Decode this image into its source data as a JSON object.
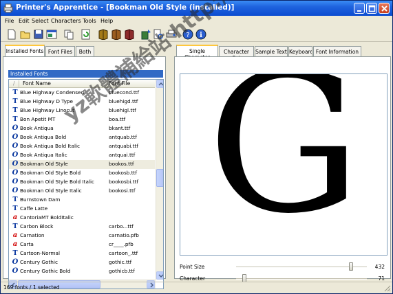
{
  "window": {
    "title": "Printer's Apprentice - [Bookman Old Style (installed)]"
  },
  "menu": [
    "File",
    "Edit",
    "Select",
    "Characters",
    "Tools",
    "Help"
  ],
  "toolbar_icons": [
    "new-icon",
    "open-icon",
    "save-icon",
    "properties-icon",
    "copy-icon",
    "refresh-icon",
    "book-icon",
    "book-red-icon",
    "book-purple-icon",
    "install-icon",
    "print-preview-icon",
    "print-icon",
    "help-icon",
    "info-icon"
  ],
  "left_tabs": [
    "Installed Fonts",
    "Font Files",
    "Both"
  ],
  "installed_header": "Installed Fonts",
  "columns": {
    "name": "Font Name",
    "file": "Font File"
  },
  "fonts": [
    {
      "type": "tt",
      "name": "Blue Highway Condensed",
      "file": "bluecond.ttf"
    },
    {
      "type": "tt",
      "name": "Blue Highway D Type",
      "file": "bluehigd.ttf"
    },
    {
      "type": "tt",
      "name": "Blue Highway Linocut",
      "file": "bluehigl.ttf"
    },
    {
      "type": "tt",
      "name": "Bon Apetit MT",
      "file": "boa.ttf"
    },
    {
      "type": "ot",
      "name": "Book Antiqua",
      "file": "bkant.ttf"
    },
    {
      "type": "ot",
      "name": "Book Antiqua Bold",
      "file": "antquab.ttf"
    },
    {
      "type": "ot",
      "name": "Book Antiqua Bold Italic",
      "file": "antquabi.ttf"
    },
    {
      "type": "ot",
      "name": "Book Antiqua Italic",
      "file": "antquai.ttf"
    },
    {
      "type": "ot",
      "name": "Bookman Old Style",
      "file": "bookos.ttf",
      "selected": true
    },
    {
      "type": "ot",
      "name": "Bookman Old Style Bold",
      "file": "bookosb.ttf"
    },
    {
      "type": "ot",
      "name": "Bookman Old Style Bold Italic",
      "file": "bookosbi.ttf"
    },
    {
      "type": "ot",
      "name": "Bookman Old Style Italic",
      "file": "bookosi.ttf"
    },
    {
      "type": "tt",
      "name": "Burnstown Dam",
      "file": ""
    },
    {
      "type": "tt",
      "name": "Caffe Latte",
      "file": ""
    },
    {
      "type": "ps",
      "name": "CantoriaMT BoldItalic",
      "file": ""
    },
    {
      "type": "tt",
      "name": "Carbon Block",
      "file": "carbo...ttf"
    },
    {
      "type": "ps",
      "name": "Carnation",
      "file": "carnatio.pfb"
    },
    {
      "type": "ps",
      "name": "Carta",
      "file": "cr____.pfb"
    },
    {
      "type": "tt",
      "name": "Cartoon-Normal",
      "file": "cartoon_.ttf"
    },
    {
      "type": "ot",
      "name": "Century Gothic",
      "file": "gothic.ttf"
    },
    {
      "type": "ot",
      "name": "Century Gothic Bold",
      "file": "gothicb.ttf"
    }
  ],
  "right_tabs": [
    "Single Character",
    "Character Set",
    "Sample Text",
    "Keyboard",
    "Font Information"
  ],
  "preview_char": "G",
  "sliders": [
    {
      "label": "Point Size",
      "value": "432",
      "fraction": 0.89
    },
    {
      "label": "Character",
      "value": "71",
      "fraction": 0.05
    }
  ],
  "status": "169 fonts / 1 selected",
  "watermark": "yz軟體補給站 http://31.to"
}
